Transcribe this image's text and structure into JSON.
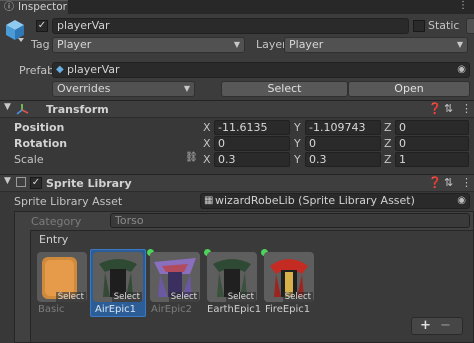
{
  "tab": {
    "label": "Inspector"
  },
  "object": {
    "name": "playerVar",
    "static_label": "Static",
    "tag_label": "Tag",
    "tag_value": "Player",
    "layer_label": "Layer",
    "layer_value": "Player",
    "prefab_label": "Prefab",
    "prefab_value": "playerVar",
    "overrides_label": "Overrides",
    "select_label": "Select",
    "open_label": "Open"
  },
  "transform": {
    "title": "Transform",
    "rows": [
      {
        "label": "Position",
        "x": "-11.6135",
        "y": "-1.109743",
        "z": "0"
      },
      {
        "label": "Rotation",
        "x": "0",
        "y": "0",
        "z": "0"
      },
      {
        "label": "Scale",
        "x": "0.3",
        "y": "0.3",
        "z": "1"
      }
    ],
    "axis": {
      "x": "X",
      "y": "Y",
      "z": "Z"
    }
  },
  "sprite_library": {
    "title": "Sprite Library",
    "asset_label": "Sprite Library Asset",
    "asset_value": "wizardRobeLib (Sprite Library Asset)",
    "category_label": "Category",
    "category_value": "Torso",
    "entry_label": "Entry",
    "select_badge": "Select",
    "entries": [
      {
        "name": "Basic",
        "dim": true
      },
      {
        "name": "AirEpic1",
        "dim": false,
        "selected": true
      },
      {
        "name": "AirEpic2",
        "dim": true
      },
      {
        "name": "EarthEpic1",
        "dim": false
      },
      {
        "name": "FireEpic1",
        "dim": false
      }
    ],
    "add_label": "+",
    "remove_label": "−"
  },
  "colors": {
    "accent": "#3a79c4",
    "override_dot": "#4dd45a",
    "background": "#383838"
  }
}
